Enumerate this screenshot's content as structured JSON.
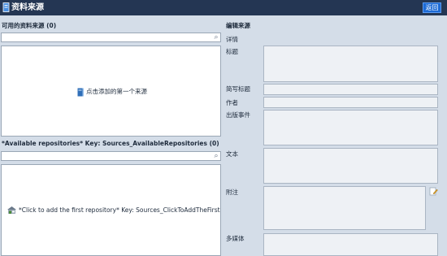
{
  "header": {
    "title": "资料来源",
    "back_label": "返回"
  },
  "available": {
    "title": "可用的资料来源 (0)",
    "search_placeholder": "",
    "empty_message": "点击添加的第一个来源"
  },
  "repositories": {
    "title": "*Available repositories* Key: Sources_AvailableRepositories (0)",
    "search_placeholder": "",
    "empty_message": "*Click to add the first repository* Key: Sources_ClickToAddTheFirstRepos"
  },
  "edit": {
    "title": "编辑来源",
    "details_label": "详情",
    "fields": {
      "title": "标题",
      "short_title": "简写标题",
      "author": "作者",
      "publication": "出版事件",
      "text": "文本",
      "notes": "附注",
      "media": "多媒体"
    }
  },
  "colors": {
    "header": "#243653",
    "accent": "#1c6ad6",
    "background": "#d4dde8"
  },
  "icons": [
    "source-doc-icon",
    "search-icon",
    "book-icon",
    "repository-icon",
    "notes-edit-icon"
  ]
}
